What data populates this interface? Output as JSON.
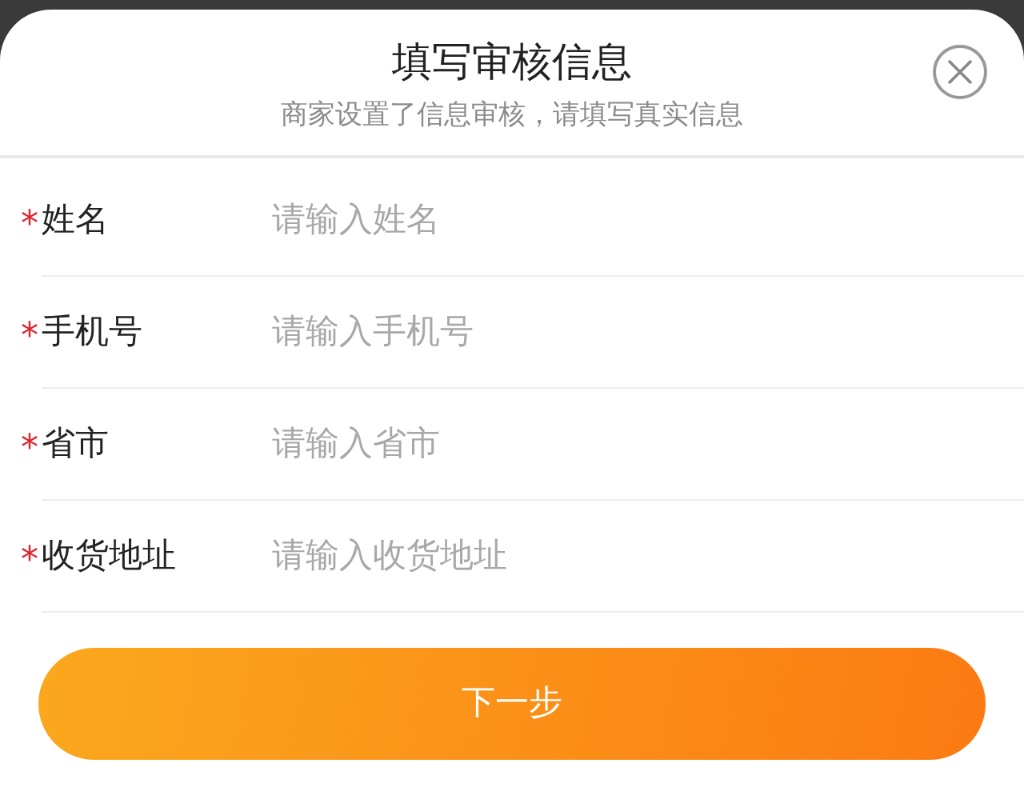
{
  "sheet": {
    "title": "填写审核信息",
    "subtitle": "商家设置了信息审核，请填写真实信息"
  },
  "fields": [
    {
      "required_mark": "*",
      "label": "姓名",
      "placeholder": "请输入姓名"
    },
    {
      "required_mark": "*",
      "label": "手机号",
      "placeholder": "请输入手机号"
    },
    {
      "required_mark": "*",
      "label": "省市",
      "placeholder": "请输入省市"
    },
    {
      "required_mark": "*",
      "label": "收货地址",
      "placeholder": "请输入收货地址"
    }
  ],
  "submit_button": "下一步"
}
